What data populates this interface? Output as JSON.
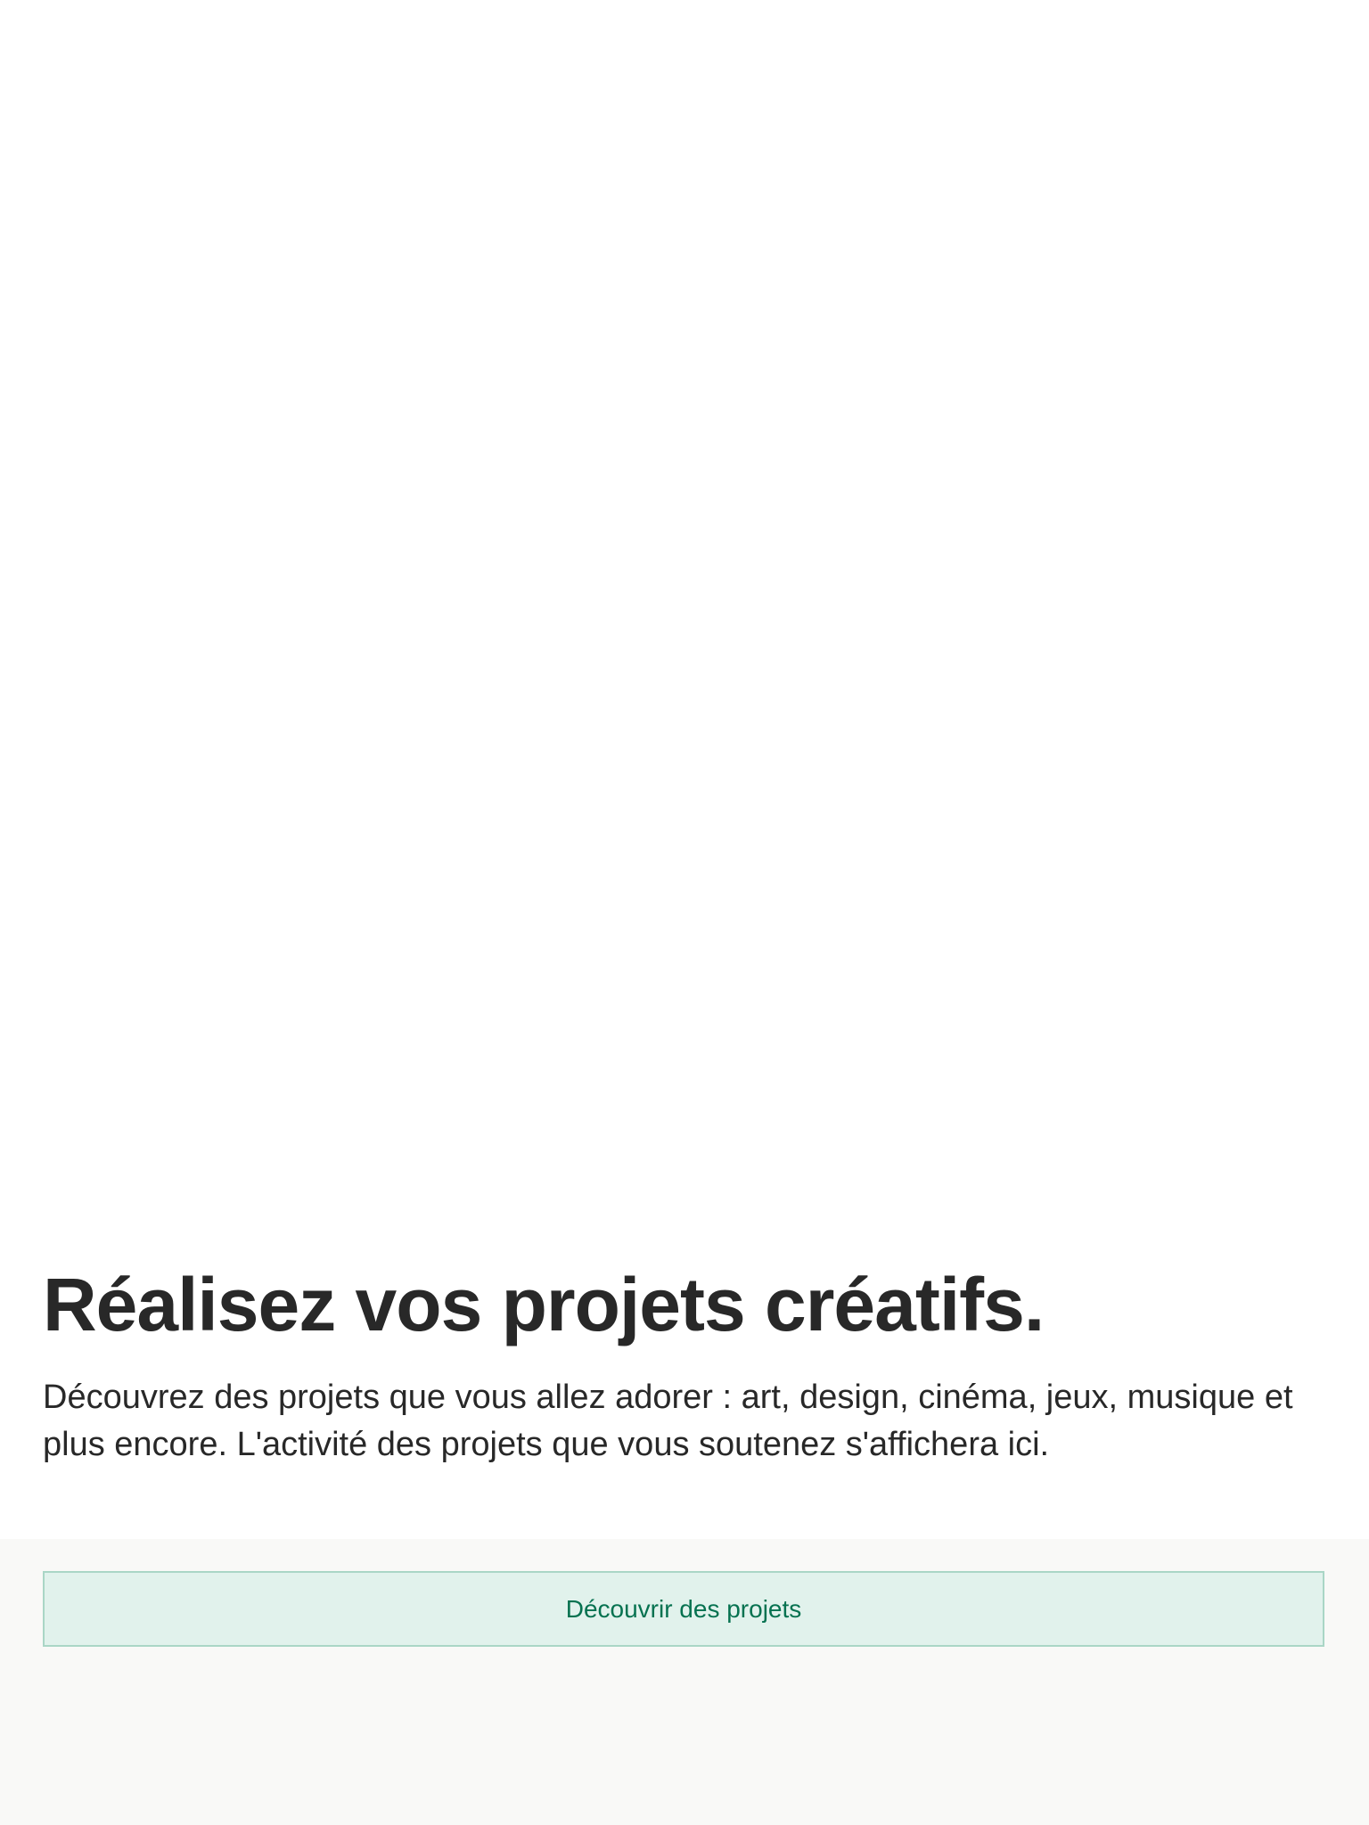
{
  "main": {
    "headline": "Réalisez vos projets créatifs.",
    "description": "Découvrez des projets que vous allez adorer : art, design, cinéma, jeux, musique et plus encore. L'activité des projets que vous soutenez s'affichera ici."
  },
  "actions": {
    "discover_label": "Découvrir des projets"
  },
  "colors": {
    "text": "#282828",
    "button_background": "#e1f2ec",
    "button_border": "#aad6c6",
    "button_text": "#067250",
    "footer_background": "#f9f9f7"
  }
}
